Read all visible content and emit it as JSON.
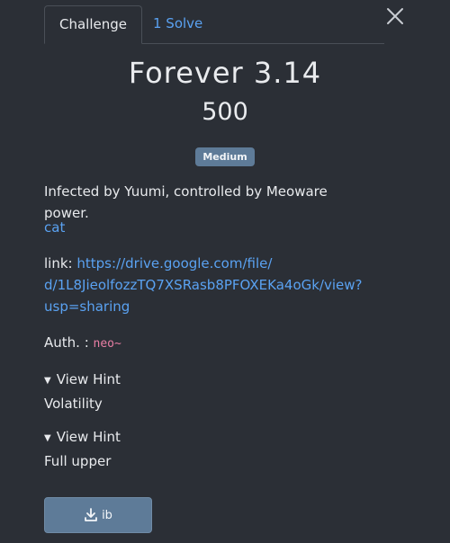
{
  "tabs": [
    {
      "label": "Challenge"
    },
    {
      "label": "1 Solve"
    }
  ],
  "challenge": {
    "title": "Forever 3.14",
    "points": "500",
    "difficulty": "Medium",
    "description": "Infected by Yuumi, controlled by Meoware power.",
    "category_link": "cat",
    "link_label": "link:",
    "link_url_line1": "https://drive.google.com/file/",
    "link_url_line2": "d/1L8JieolfozzTQ7XSRasb8PFOXEKa4oGk/view?",
    "link_url_line3": "usp=sharing",
    "author_label": "Auth. :",
    "author_name": "neo~"
  },
  "hints": [
    {
      "summary": "View Hint",
      "content": "Volatility"
    },
    {
      "summary": "View Hint",
      "content": "Full upper"
    }
  ],
  "download": {
    "label": "ib",
    "icon": "download-icon"
  },
  "colors": {
    "background": "#2b2f36",
    "link": "#5aa2f2",
    "badge": "#5e7b98",
    "author": "#e87ea4"
  }
}
